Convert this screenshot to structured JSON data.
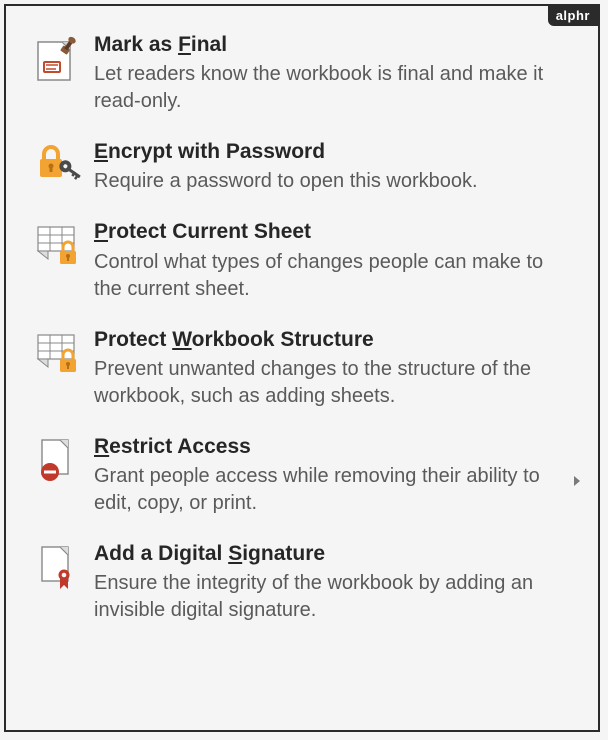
{
  "watermark": "alphr",
  "menu": {
    "items": [
      {
        "id": "mark-as-final",
        "title_pre": "Mark as ",
        "title_mn": "F",
        "title_post": "inal",
        "desc": "Let readers know the workbook is final and make it read-only.",
        "submenu": false
      },
      {
        "id": "encrypt-with-password",
        "title_pre": "",
        "title_mn": "E",
        "title_post": "ncrypt with Password",
        "desc": "Require a password to open this workbook.",
        "submenu": false
      },
      {
        "id": "protect-current-sheet",
        "title_pre": "",
        "title_mn": "P",
        "title_post": "rotect Current Sheet",
        "desc": "Control what types of changes people can make to the current sheet.",
        "submenu": false
      },
      {
        "id": "protect-workbook-structure",
        "title_pre": "Protect ",
        "title_mn": "W",
        "title_post": "orkbook Structure",
        "desc": "Prevent unwanted changes to the structure of the workbook, such as adding sheets.",
        "submenu": false
      },
      {
        "id": "restrict-access",
        "title_pre": "",
        "title_mn": "R",
        "title_post": "estrict Access",
        "desc": "Grant people access while removing their ability to edit, copy, or print.",
        "submenu": true
      },
      {
        "id": "add-digital-signature",
        "title_pre": "Add a Digital ",
        "title_mn": "S",
        "title_post": "ignature",
        "desc": "Ensure the integrity of the workbook by adding an invisible digital signature.",
        "submenu": false
      }
    ]
  }
}
